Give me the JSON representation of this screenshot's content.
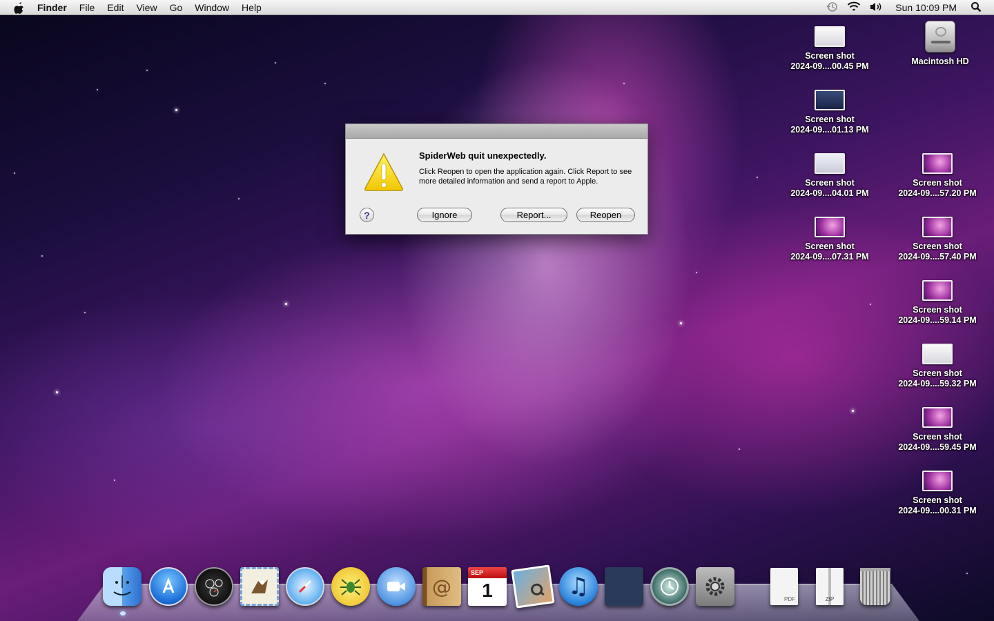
{
  "menubar": {
    "apple": "apple-icon",
    "items": [
      "Finder",
      "File",
      "Edit",
      "View",
      "Go",
      "Window",
      "Help"
    ],
    "clock": "Sun 10:09 PM",
    "status_icons": [
      "time-machine-icon",
      "wifi-icon",
      "volume-icon",
      "spotlight-icon"
    ]
  },
  "desktop": {
    "drive": {
      "label": "Macintosh HD"
    },
    "left_column": [
      {
        "line1": "Screen shot",
        "line2": "2024-09....00.45 PM",
        "thumb": "white"
      },
      {
        "line1": "Screen shot",
        "line2": "2024-09....01.13 PM",
        "thumb": "blue"
      },
      {
        "line1": "Screen shot",
        "line2": "2024-09....04.01 PM",
        "thumb": "doc"
      },
      {
        "line1": "Screen shot",
        "line2": "2024-09....07.31 PM",
        "thumb": "pink"
      }
    ],
    "right_column": [
      {
        "line1": "Screen shot",
        "line2": "2024-09....57.20 PM",
        "thumb": "pink"
      },
      {
        "line1": "Screen shot",
        "line2": "2024-09....57.40 PM",
        "thumb": "pink"
      },
      {
        "line1": "Screen shot",
        "line2": "2024-09....59.14 PM",
        "thumb": "pink"
      },
      {
        "line1": "Screen shot",
        "line2": "2024-09....59.32 PM",
        "thumb": "white"
      },
      {
        "line1": "Screen shot",
        "line2": "2024-09....59.45 PM",
        "thumb": "pink"
      },
      {
        "line1": "Screen shot",
        "line2": "2024-09....00.31 PM",
        "thumb": "pink"
      }
    ]
  },
  "dialog": {
    "heading": "SpiderWeb quit unexpectedly.",
    "message": "Click Reopen to open the application again. Click Report to see more detailed information and send a report to Apple.",
    "help_label": "?",
    "buttons": {
      "ignore": "Ignore",
      "report": "Report...",
      "reopen": "Reopen"
    }
  },
  "dock": {
    "items": [
      "finder-icon",
      "app-store-icon",
      "dashboard-icon",
      "mail-icon",
      "safari-icon",
      "spiderweb-icon",
      "facetime-icon",
      "address-book-icon",
      "ical-icon",
      "iphoto-icon",
      "itunes-icon",
      "spaces-icon",
      "time-machine-icon",
      "system-preferences-icon",
      "documents-stack-icon",
      "downloads-stack-icon",
      "trash-icon"
    ],
    "ical_month": "SEP",
    "ical_day": "1",
    "pdf_label": "PDF",
    "zip_label": "ZIP"
  }
}
